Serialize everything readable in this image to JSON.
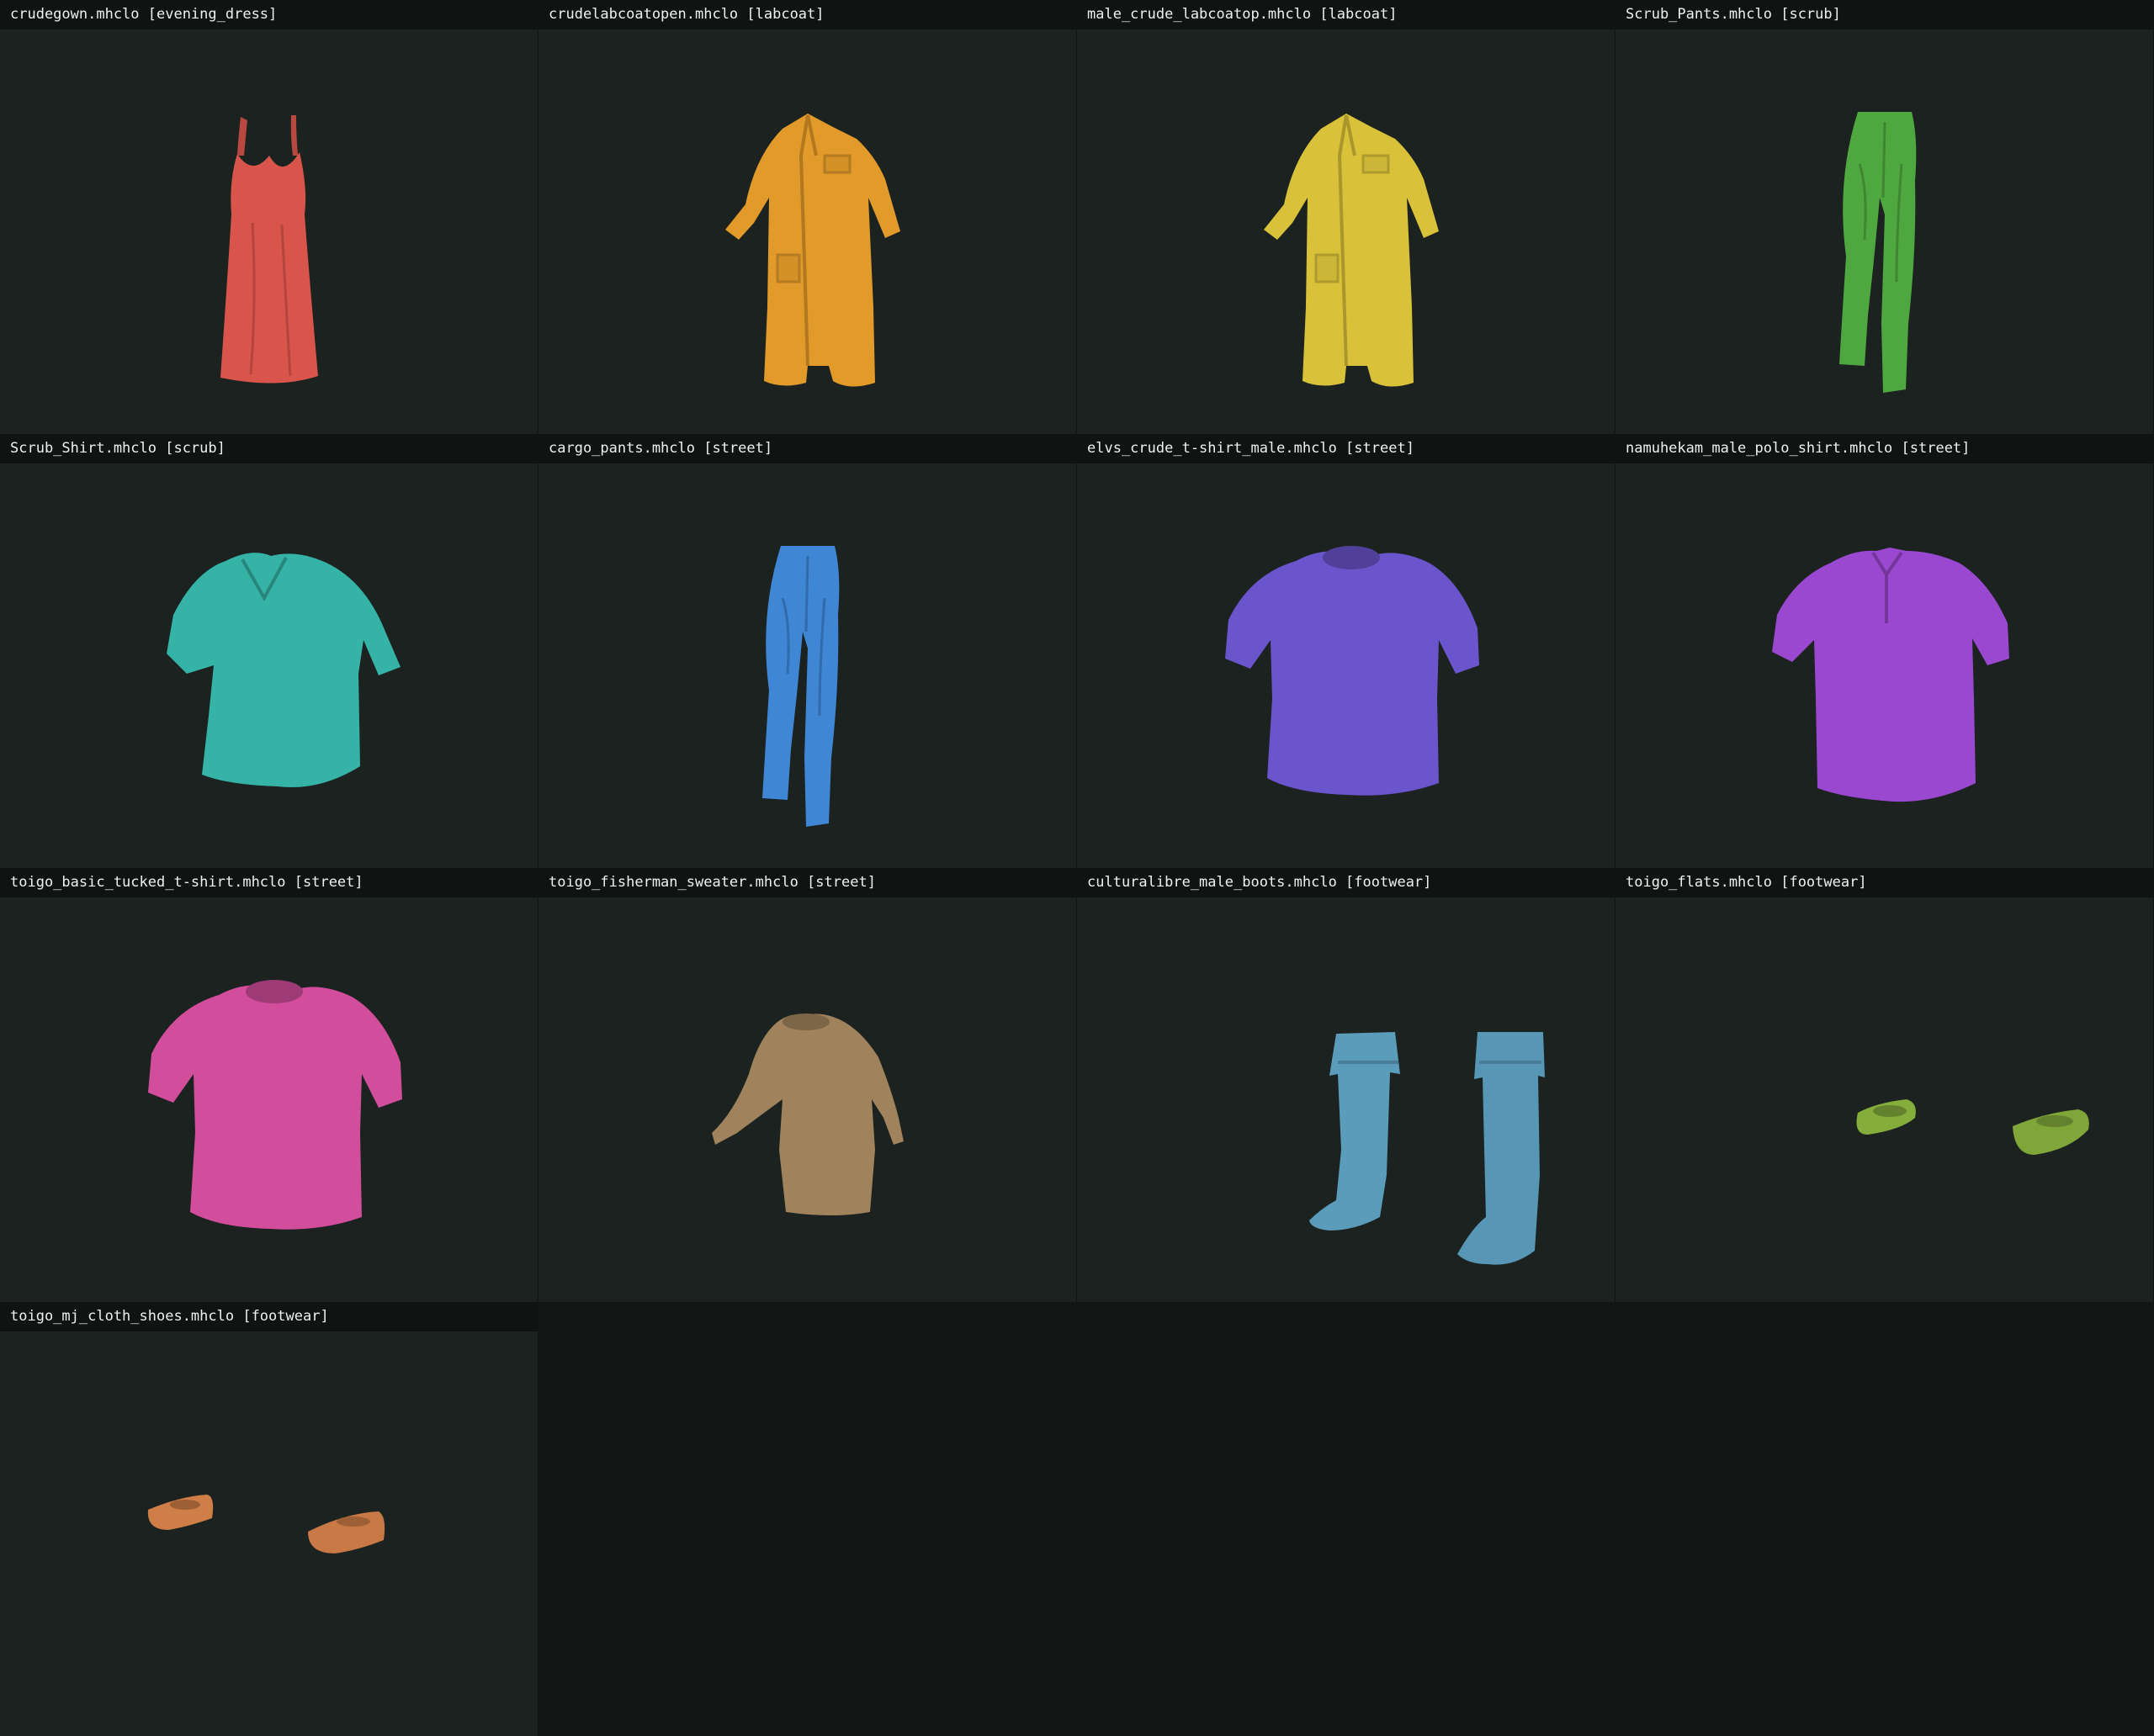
{
  "grid": {
    "background": "#111614",
    "cell_background": "#1b2220",
    "header_background": "#0f1412",
    "items": [
      {
        "label": "crudegown.mhclo [evening_dress]",
        "file": "crudegown.mhclo",
        "category": "evening_dress",
        "icon": "evening-dress-icon",
        "color": "#d9554b"
      },
      {
        "label": "crudelabcoatopen.mhclo [labcoat]",
        "file": "crudelabcoatopen.mhclo",
        "category": "labcoat",
        "icon": "labcoat-icon",
        "color": "#e29a2a"
      },
      {
        "label": "male_crude_labcoatop.mhclo [labcoat]",
        "file": "male_crude_labcoatop.mhclo",
        "category": "labcoat",
        "icon": "labcoat-icon",
        "color": "#d9c23a"
      },
      {
        "label": "Scrub_Pants.mhclo [scrub]",
        "file": "Scrub_Pants.mhclo",
        "category": "scrub",
        "icon": "pants-icon",
        "color": "#4fa83f"
      },
      {
        "label": "Scrub_Shirt.mhclo [scrub]",
        "file": "Scrub_Shirt.mhclo",
        "category": "scrub",
        "icon": "womens-shirt-icon",
        "color": "#35b3a6"
      },
      {
        "label": "cargo_pants.mhclo [street]",
        "file": "cargo_pants.mhclo",
        "category": "street",
        "icon": "pants-icon",
        "color": "#3f86d4"
      },
      {
        "label": "elvs_crude_t-shirt_male.mhclo [street]",
        "file": "elvs_crude_t-shirt_male.mhclo",
        "category": "street",
        "icon": "t-shirt-icon",
        "color": "#6a55cc"
      },
      {
        "label": "namuhekam_male_polo_shirt.mhclo [street]",
        "file": "namuhekam_male_polo_shirt.mhclo",
        "category": "street",
        "icon": "polo-shirt-icon",
        "color": "#9a48cf"
      },
      {
        "label": "toigo_basic_tucked_t-shirt.mhclo [street]",
        "file": "toigo_basic_tucked_t-shirt.mhclo",
        "category": "street",
        "icon": "t-shirt-icon",
        "color": "#d24d9c"
      },
      {
        "label": "toigo_fisherman_sweater.mhclo [street]",
        "file": "toigo_fisherman_sweater.mhclo",
        "category": "street",
        "icon": "sweater-icon",
        "color": "#a0835c"
      },
      {
        "label": "culturalibre_male_boots.mhclo [footwear]",
        "file": "culturalibre_male_boots.mhclo",
        "category": "footwear",
        "icon": "boots-icon",
        "color": "#5b9cbb"
      },
      {
        "label": "toigo_flats.mhclo [footwear]",
        "file": "toigo_flats.mhclo",
        "category": "footwear",
        "icon": "flats-icon",
        "color": "#85ad3c"
      },
      {
        "label": "toigo_mj_cloth_shoes.mhclo [footwear]",
        "file": "toigo_mj_cloth_shoes.mhclo",
        "category": "footwear",
        "icon": "cloth-shoes-icon",
        "color": "#d07e48"
      }
    ]
  }
}
